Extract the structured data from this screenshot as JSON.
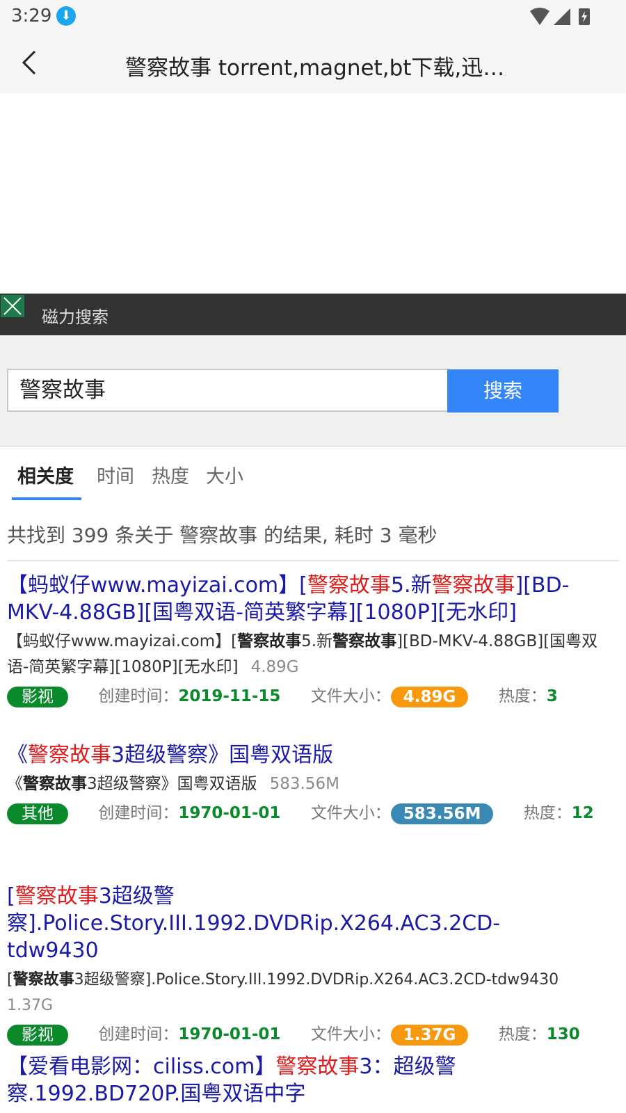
{
  "status": {
    "time": "3:29"
  },
  "appbar": {
    "title": "警察故事 torrent,magnet,bt下载,迅…"
  },
  "magnet_bar": {
    "label": "磁力搜索"
  },
  "search": {
    "value": "警察故事",
    "button_label": "搜索"
  },
  "tabs": [
    {
      "label": "相关度"
    },
    {
      "label": "时间"
    },
    {
      "label": "热度"
    },
    {
      "label": "大小"
    }
  ],
  "summary": "共找到 399 条关于 警察故事 的结果, 耗时 3 毫秒",
  "labels": {
    "created": "创建时间：",
    "size": "文件大小：",
    "heat": "热度："
  },
  "colors": {
    "accent": "#3485f7",
    "highlight": "#e01b1b",
    "link": "#1a1aa6",
    "green": "#0b8a2c",
    "orange": "#f7980f",
    "teal": "#3989b4"
  },
  "results": [
    {
      "title_parts": [
        "【蚂蚁仔www.mayizai.com】[",
        "警察故事",
        "5.新",
        "警察故事",
        "][BD-MKV-4.88GB][国粤双语-简英繁字幕][1080P][无水印]"
      ],
      "desc_parts": [
        "【蚂蚁仔www.mayizai.com】[",
        "警察故事",
        "5.新",
        "警察故事",
        "][BD-MKV-4.88GB][国粤双语-简英繁字幕][1080P][无水印]"
      ],
      "size": "4.89G",
      "category": "影视",
      "created": "2019-11-15",
      "heat": "3"
    },
    {
      "title_parts": [
        "《",
        "警察故事",
        "3超级警察》国粤双语版"
      ],
      "desc_parts": [
        "《",
        "警察故事",
        "3超级警察》国粤双语版"
      ],
      "size": "583.56M",
      "category": "其他",
      "created": "1970-01-01",
      "heat": "12"
    },
    {
      "title_parts": [
        "[",
        "警察故事",
        "3超级警察].Police.Story.III.1992.DVDRip.X264.AC3.2CD-tdw9430"
      ],
      "desc_parts": [
        "[",
        "警察故事",
        "3超级警察].Police.Story.III.1992.DVDRip.X264.AC3.2CD-tdw9430"
      ],
      "size": "1.37G",
      "category": "影视",
      "created": "1970-01-01",
      "heat": "130"
    },
    {
      "title_parts": [
        "【爱看电影网：ciliss.com】",
        "警察故事",
        "3：超级警察.1992.BD720P.国粤双语中字"
      ]
    }
  ]
}
